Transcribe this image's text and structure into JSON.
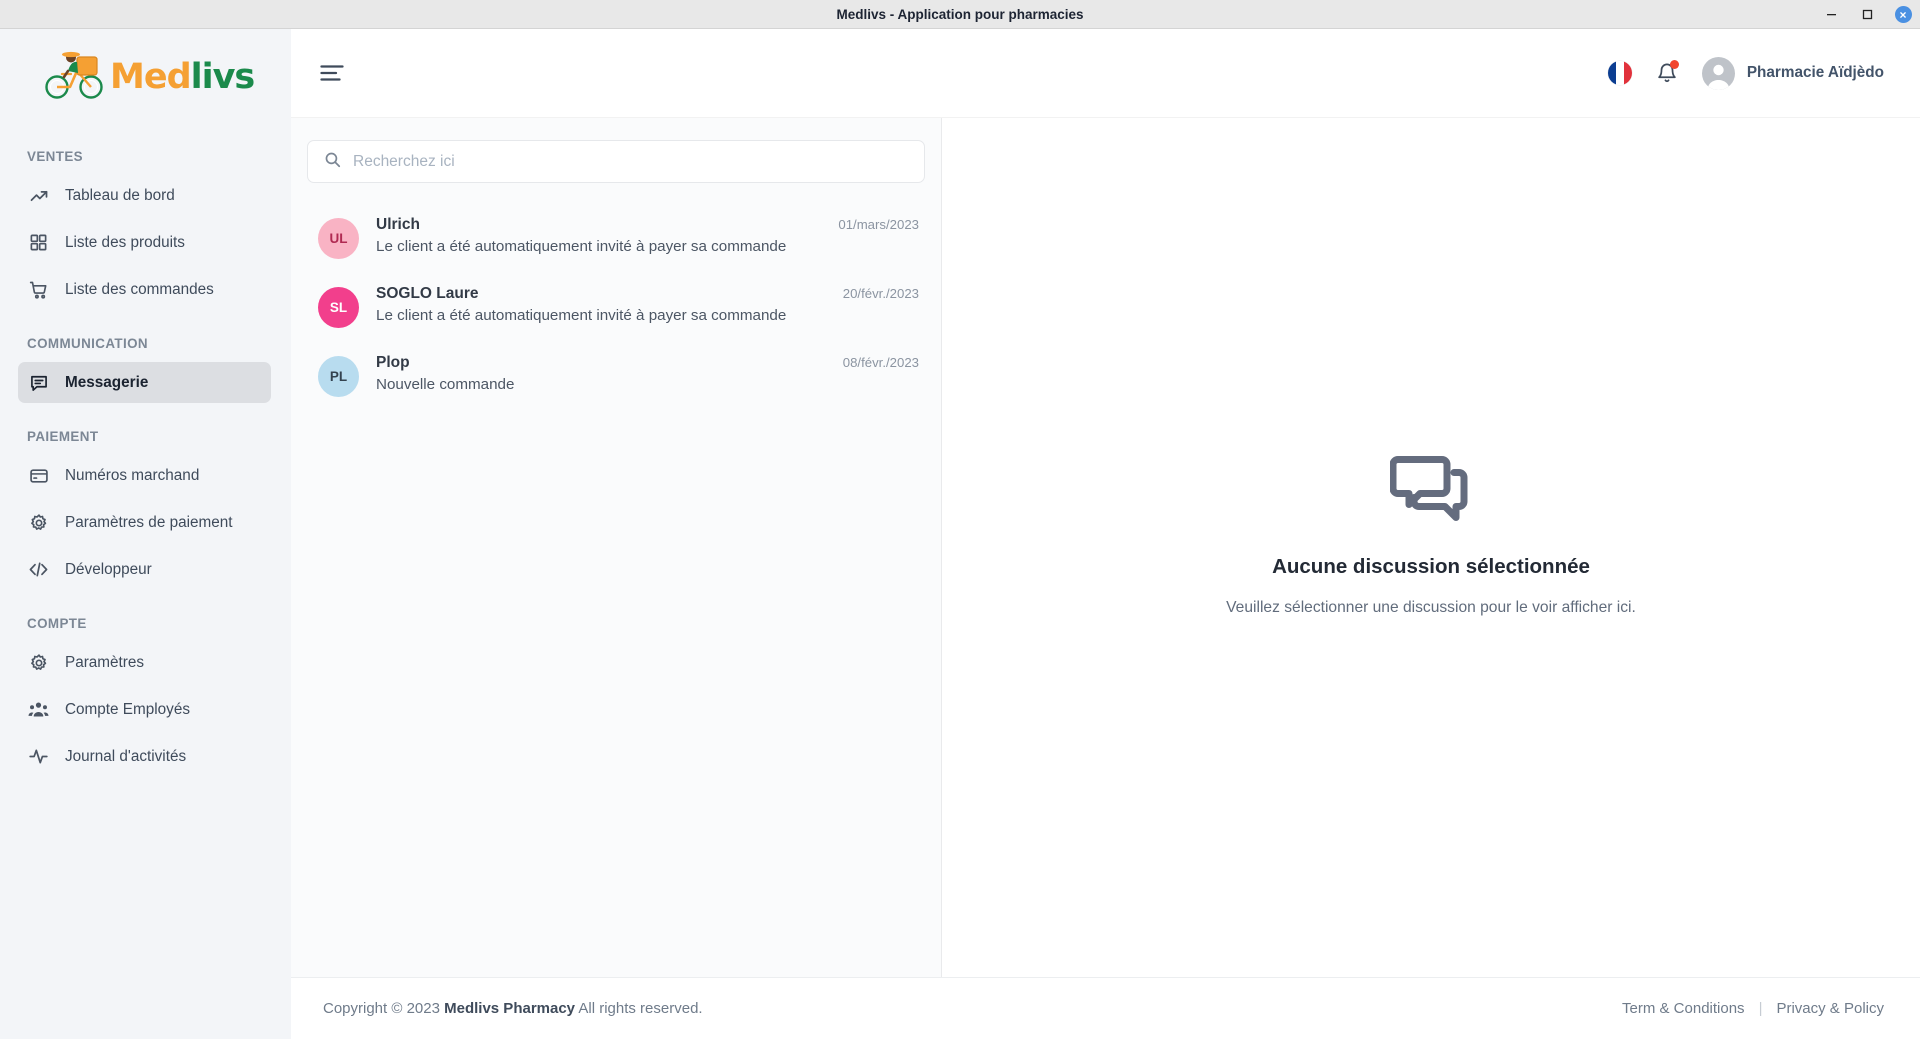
{
  "window": {
    "title": "Medlivs - Application pour pharmacies",
    "controls": {
      "minimize": "minimize-icon",
      "maximize": "maximize-icon",
      "close": "×"
    }
  },
  "brand": {
    "part1": "Med",
    "part2": "livs",
    "logo_icon": "delivery-cyclist-logo"
  },
  "sidebar": {
    "sections": [
      {
        "title": "VENTES",
        "items": [
          {
            "label": "Tableau de bord",
            "icon": "trending-up-icon",
            "active": false
          },
          {
            "label": "Liste des produits",
            "icon": "grid-icon",
            "active": false
          },
          {
            "label": "Liste des commandes",
            "icon": "shopping-cart-icon",
            "active": false
          }
        ]
      },
      {
        "title": "COMMUNICATION",
        "items": [
          {
            "label": "Messagerie",
            "icon": "chat-icon",
            "active": true
          }
        ]
      },
      {
        "title": "PAIEMENT",
        "items": [
          {
            "label": "Numéros marchand",
            "icon": "credit-card-icon",
            "active": false
          },
          {
            "label": "Paramètres de paiement",
            "icon": "gear-icon",
            "active": false
          },
          {
            "label": "Développeur",
            "icon": "code-icon",
            "active": false
          }
        ]
      },
      {
        "title": "COMPTE",
        "items": [
          {
            "label": "Paramètres",
            "icon": "gear-icon",
            "active": false
          },
          {
            "label": "Compte Employés",
            "icon": "users-icon",
            "active": false
          },
          {
            "label": "Journal d'activités",
            "icon": "activity-icon",
            "active": false
          }
        ]
      }
    ]
  },
  "topbar": {
    "menu_toggle_icon": "hamburger-icon",
    "language_flag": "french-flag-icon",
    "notification_icon": "bell-icon",
    "notification_has_badge": true,
    "profile_name": "Pharmacie Aïdjèdo",
    "avatar_icon": "user-avatar-icon"
  },
  "search": {
    "placeholder": "Recherchez ici",
    "value": "",
    "icon": "search-icon"
  },
  "conversations": [
    {
      "initials": "UL",
      "avatar_color": "#f9b3c4",
      "name": "Ulrich",
      "preview": "Le client a été automatiquement invité à payer sa commande",
      "date": "01/mars/2023"
    },
    {
      "initials": "SL",
      "avatar_color": "#f23f8c",
      "name": "SOGLO Laure",
      "preview": "Le client a été automatiquement invité à payer sa commande",
      "date": "20/févr./2023"
    },
    {
      "initials": "PL",
      "avatar_color": "#b8dcef",
      "name": "Plop",
      "preview": "Nouvelle commande",
      "date": "08/févr./2023"
    }
  ],
  "empty_state": {
    "icon": "chat-bubbles-icon",
    "title": "Aucune discussion sélectionnée",
    "subtitle": "Veuillez sélectionner une discussion pour le voir afficher ici."
  },
  "footer": {
    "copyright_prefix": "Copyright © 2023",
    "company": "Medlivs Pharmacy",
    "copyright_suffix": "All rights reserved.",
    "terms": "Term & Conditions",
    "separator": "|",
    "privacy": "Privacy & Policy"
  },
  "colors": {
    "brand_orange": "#f5a033",
    "brand_green": "#1b8a4b",
    "sidebar_bg": "#f3f5f8",
    "active_item_bg": "#dcdee2",
    "notification_red": "#f1462e"
  }
}
